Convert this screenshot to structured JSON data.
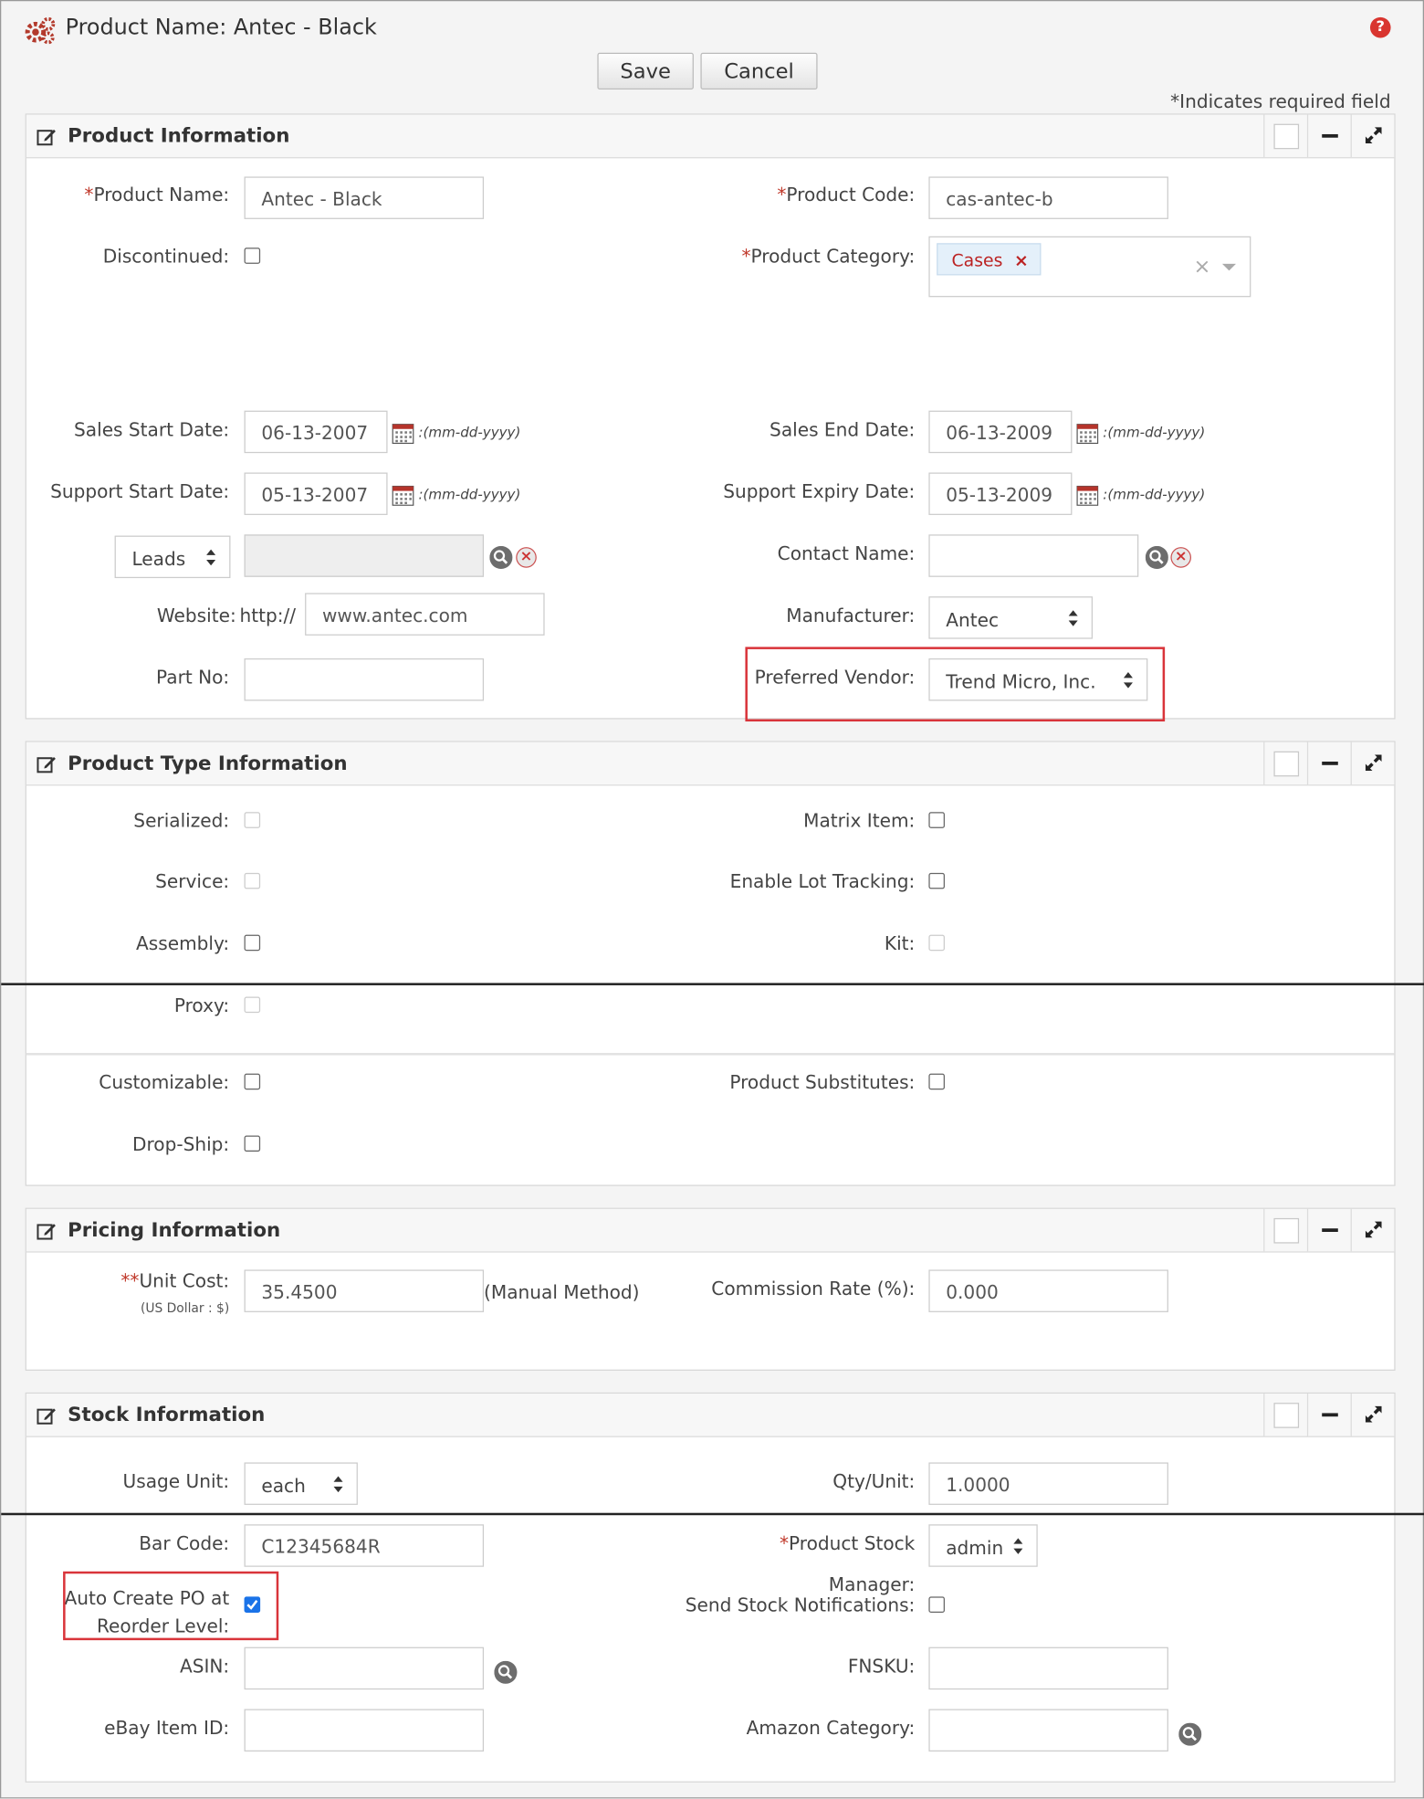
{
  "header": {
    "title": "Product Name: Antec - Black",
    "save_label": "Save",
    "cancel_label": "Cancel",
    "required_note": "*Indicates required field"
  },
  "product_info": {
    "title": "Product Information",
    "product_name_label": "Product Name:",
    "product_name_value": "Antec - Black",
    "product_code_label": "Product Code:",
    "product_code_value": "cas-antec-b",
    "discontinued_label": "Discontinued:",
    "product_category_label": "Product Category:",
    "category_tag": "Cases",
    "sales_start_label": "Sales Start Date:",
    "sales_start_value": "06-13-2007",
    "sales_end_label": "Sales End Date:",
    "sales_end_value": "06-13-2009",
    "support_start_label": "Support Start Date:",
    "support_start_value": "05-13-2007",
    "support_expiry_label": "Support Expiry Date:",
    "support_expiry_value": "05-13-2009",
    "date_format": ":(mm-dd-yyyy)",
    "related_select": "Leads",
    "contact_name_label": "Contact Name:",
    "website_label": "Website:",
    "website_prefix": "http://",
    "website_value": "www.antec.com",
    "manufacturer_label": "Manufacturer:",
    "manufacturer_value": "Antec",
    "part_no_label": "Part No:",
    "preferred_vendor_label": "Preferred Vendor:",
    "preferred_vendor_value": "Trend Micro, Inc."
  },
  "product_type": {
    "title": "Product Type Information",
    "serialized_label": "Serialized:",
    "matrix_item_label": "Matrix Item:",
    "service_label": "Service:",
    "lot_tracking_label": "Enable Lot Tracking:",
    "assembly_label": "Assembly:",
    "kit_label": "Kit:",
    "proxy_label": "Proxy:",
    "customizable_label": "Customizable:",
    "substitutes_label": "Product Substitutes:",
    "drop_ship_label": "Drop-Ship:"
  },
  "pricing": {
    "title": "Pricing Information",
    "unit_cost_label": "Unit Cost:",
    "unit_cost_stars": "**",
    "currency_note": "(US Dollar : $)",
    "unit_cost_value": "35.4500",
    "method_note": "(Manual Method)",
    "commission_label": "Commission Rate (%):",
    "commission_value": "0.000"
  },
  "stock": {
    "title": "Stock Information",
    "usage_unit_label": "Usage Unit:",
    "usage_unit_value": "each",
    "qty_unit_label": "Qty/Unit:",
    "qty_unit_value": "1.0000",
    "bar_code_label": "Bar Code:",
    "bar_code_value": "C12345684R",
    "stock_manager_label_1": "Product Stock",
    "stock_manager_label_2": "Manager:",
    "stock_manager_value": "admin",
    "auto_po_label_1": "Auto Create PO at",
    "auto_po_label_2": "Reorder Level:",
    "send_notifications_label": "Send Stock Notifications:",
    "asin_label": "ASIN:",
    "fnsku_label": "FNSKU:",
    "ebay_label": "eBay Item ID:",
    "amazon_category_label": "Amazon Category:"
  },
  "colors": {
    "accent": "#1a73e8",
    "required": "#c0392b",
    "highlight": "#d9343a"
  }
}
